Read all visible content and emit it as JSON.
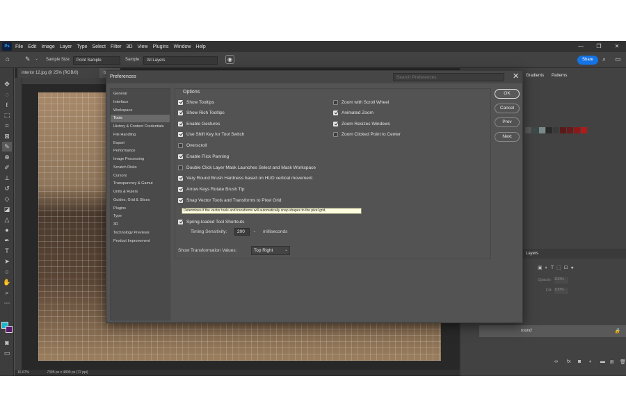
{
  "menubar": {
    "logo": "Ps",
    "items": [
      "File",
      "Edit",
      "Image",
      "Layer",
      "Type",
      "Select",
      "Filter",
      "3D",
      "View",
      "Plugins",
      "Window",
      "Help"
    ]
  },
  "options_bar": {
    "sample_size_label": "Sample Size:",
    "sample_size_value": "Point Sample",
    "sample_label": "Sample:",
    "sample_value": "All Layers",
    "share_label": "Share"
  },
  "document": {
    "tab_title": "interior 12.jpg @ 25% (RGB/8)",
    "tab2_title": "bac",
    "zoom": "16.67%",
    "dimensions": "7395 px x 4800 px (72 ppi)"
  },
  "right_panel": {
    "tabs": [
      "Gradients",
      "Patterns"
    ],
    "layers_tab": "Layers",
    "opacity_label": "Opacity:",
    "opacity_value": "100%",
    "fill_label": "Fill:",
    "fill_value": "100%",
    "layer_name": "round",
    "swatch_colors": [
      "#5a5a5a",
      "#3c4a4a",
      "#7a8a8a",
      "#2a2a2a",
      "#3a3a3a",
      "#5a1a1a",
      "#6a1a1a",
      "#8a1a1a",
      "#b01a1a"
    ]
  },
  "preferences": {
    "title": "Preferences",
    "search_placeholder": "Search Preferences",
    "nav": [
      "General",
      "Interface",
      "Workspace",
      "Tools",
      "History & Content Credentials",
      "File Handling",
      "Export",
      "Performance",
      "Image Processing",
      "Scratch Disks",
      "Cursors",
      "Transparency & Gamut",
      "Units & Rulers",
      "Guides, Grid & Slices",
      "Plugins",
      "Type",
      "3D",
      "Technology Previews",
      "Product Improvement"
    ],
    "selected_nav": "Tools",
    "options_title": "Options",
    "left_options": [
      {
        "label": "Show Tooltips",
        "checked": true
      },
      {
        "label": "Show Rich Tooltips",
        "checked": true
      },
      {
        "label": "Enable Gestures",
        "checked": true
      },
      {
        "label": "Use Shift Key for Tool Switch",
        "checked": true
      },
      {
        "label": "Overscroll",
        "checked": false
      },
      {
        "label": "Enable Flick Panning",
        "checked": true
      },
      {
        "label": "Double Click Layer Mask Launches Select and Mask Workspace",
        "checked": false
      },
      {
        "label": "Vary Round Brush Hardness based on HUD vertical movement",
        "checked": true
      },
      {
        "label": "Arrow Keys Rotate Brush Tip",
        "checked": true
      },
      {
        "label": "Snap Vector Tools and Transforms to Pixel Grid",
        "checked": true
      },
      {
        "label": "Spring-loaded Tool Shortcuts",
        "checked": true
      }
    ],
    "right_options": [
      {
        "label": "Zoom with Scroll Wheel",
        "checked": false
      },
      {
        "label": "Animated Zoom",
        "checked": true
      },
      {
        "label": "Zoom Resizes Windows",
        "checked": true
      },
      {
        "label": "Zoom Clicked Point to Center",
        "checked": false
      }
    ],
    "tooltip": "Determines if the vector tools and transforms will automatically snap shapes to the pixel grid.",
    "timing_label": "Timing Sensitivity:",
    "timing_value": "200",
    "timing_unit": "milliseconds",
    "transform_label": "Show Transformation Values:",
    "transform_value": "Top Right",
    "buttons": {
      "ok": "OK",
      "cancel": "Cancel",
      "prev": "Prev",
      "next": "Next"
    }
  }
}
